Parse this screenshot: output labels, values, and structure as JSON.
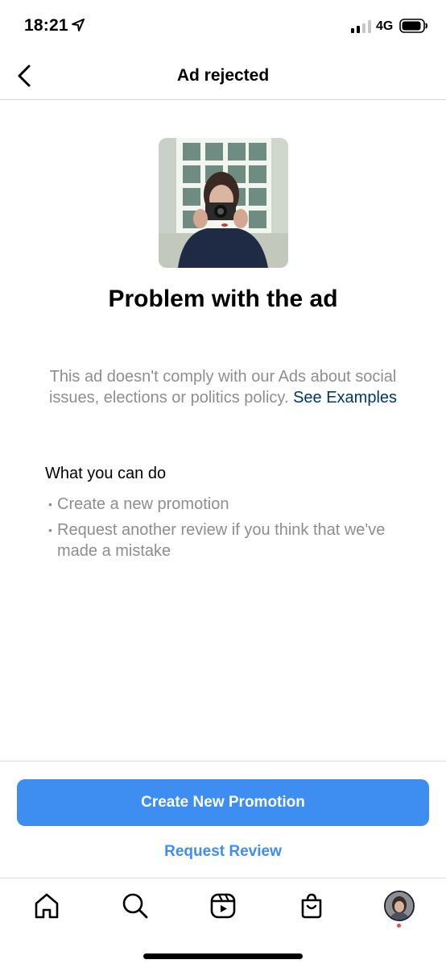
{
  "status_bar": {
    "time": "18:21",
    "network": "4G",
    "icons": [
      "location-arrow-icon",
      "signal-icon",
      "battery-icon"
    ]
  },
  "header": {
    "title": "Ad rejected",
    "back_icon": "chevron-left-icon"
  },
  "main": {
    "title": "Problem with the ad",
    "description": "This ad doesn't comply with our Ads about social issues, elections or politics policy.",
    "see_examples_link": "See Examples",
    "what_you_can_do_heading": "What you can do",
    "actions": [
      "Create a new promotion",
      "Request another review if you think that we've made a mistake"
    ]
  },
  "buttons": {
    "primary": "Create New Promotion",
    "secondary": "Request Review"
  },
  "tab_bar": {
    "items": [
      "home-icon",
      "search-icon",
      "reels-icon",
      "shop-icon",
      "profile-avatar"
    ]
  },
  "colors": {
    "accent": "#3d8ef0",
    "link": "#00376b",
    "muted_text": "#8e8e8e",
    "notification": "#ed4956"
  }
}
